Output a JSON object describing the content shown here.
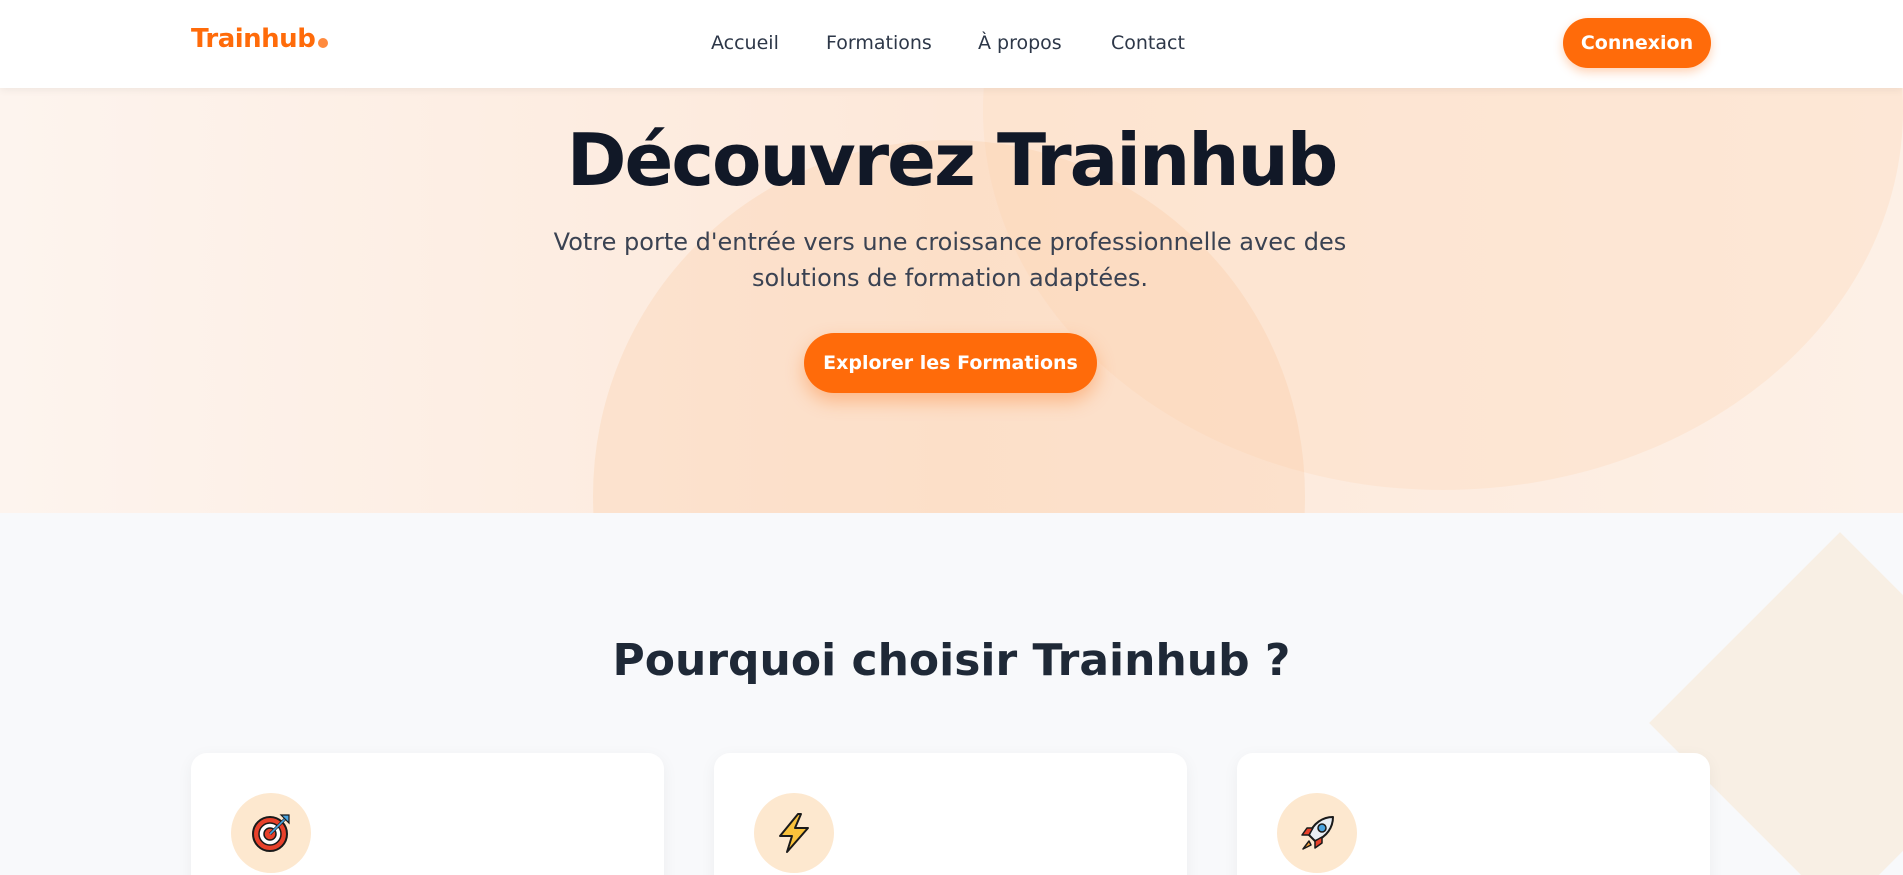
{
  "header": {
    "logo": "Trainhub",
    "nav": {
      "accueil": "Accueil",
      "formations": "Formations",
      "apropos": "À propos",
      "contact": "Contact"
    },
    "login_label": "Connexion"
  },
  "hero": {
    "title": "Découvrez Trainhub",
    "subtitle": "Votre porte d'entrée vers une croissance professionnelle avec des solutions de formation adaptées.",
    "cta_label": "Explorer les Formations"
  },
  "features": {
    "title": "Pourquoi choisir Trainhub ?",
    "cards": [
      {
        "icon": "target-icon"
      },
      {
        "icon": "lightning-icon"
      },
      {
        "icon": "rocket-icon"
      }
    ]
  },
  "colors": {
    "accent": "#ff6b0a",
    "heading": "#111827",
    "text": "#3a4252",
    "icon_bg": "#fde8cf"
  }
}
